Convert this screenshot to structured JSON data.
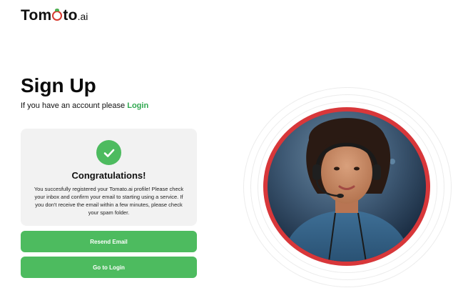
{
  "brand": {
    "name_part1": "Tom",
    "name_part2": "to",
    "suffix": ".ai"
  },
  "page": {
    "title": "Sign Up",
    "prompt_text": "If you have an account please",
    "login_link": "Login"
  },
  "success": {
    "title": "Congratulations!",
    "message": "You succesfully registered your Tomato.ai profile! Please check your inbox and confirm your email to starting using a service. If you don't receive the email within a few minutes, please check your spam folder."
  },
  "buttons": {
    "resend": "Resend Email",
    "go_to_login": "Go to Login"
  },
  "colors": {
    "accent": "#4dbb5f",
    "brand_red": "#d63a2f",
    "card_bg": "#f2f2f2"
  },
  "icons": {
    "success": "check-icon"
  },
  "image": {
    "portrait": "woman with headset avatar"
  }
}
